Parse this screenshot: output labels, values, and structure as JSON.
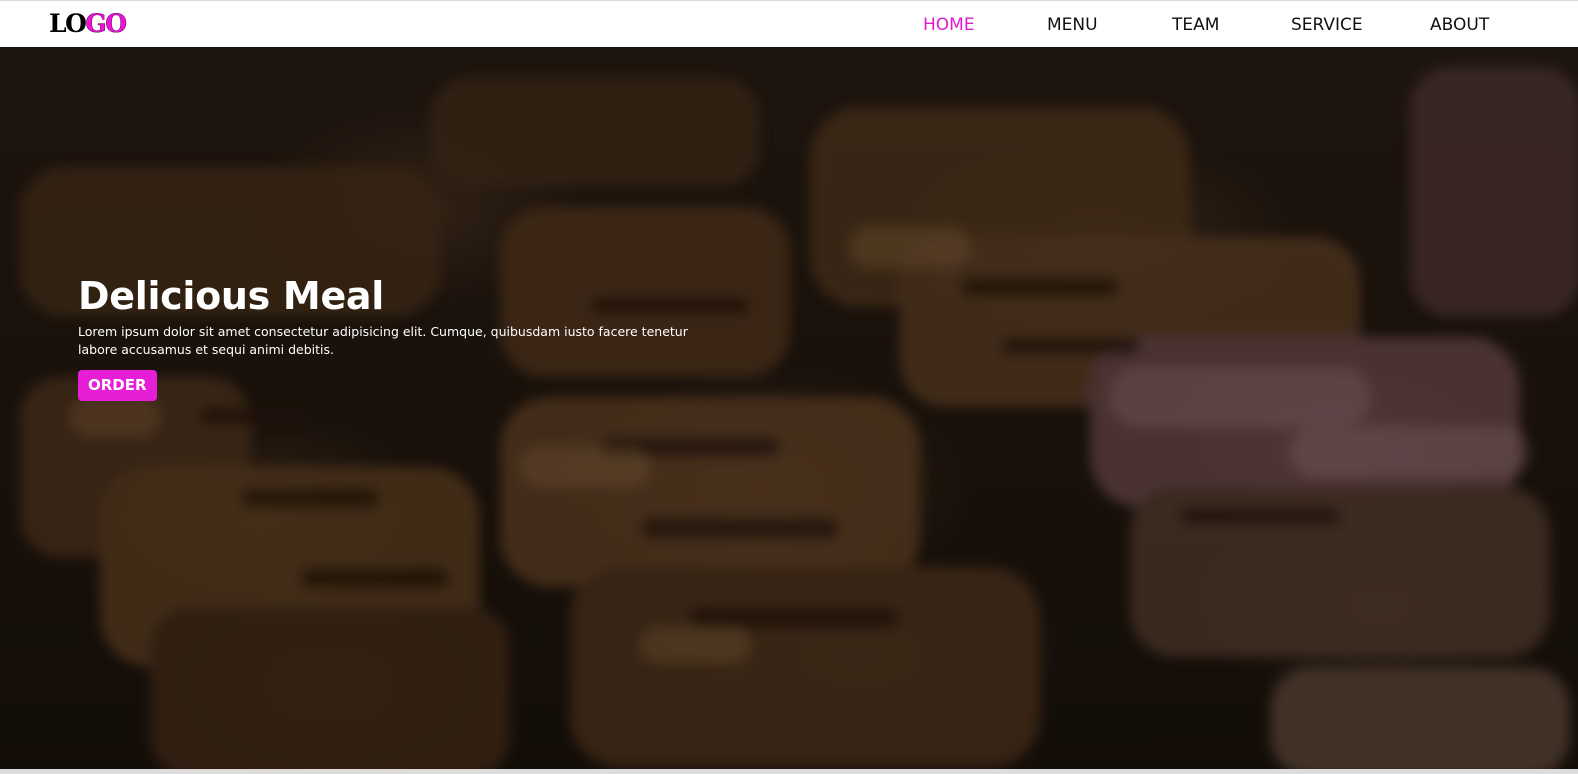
{
  "brand": {
    "logo_part1": "LO",
    "logo_part2": "GO",
    "accent_color": "#e61ed6"
  },
  "nav": {
    "items": [
      {
        "label": "HOME",
        "active": true
      },
      {
        "label": "MENU",
        "active": false
      },
      {
        "label": "TEAM",
        "active": false
      },
      {
        "label": "SERVICE",
        "active": false
      },
      {
        "label": "ABOUT",
        "active": false
      }
    ]
  },
  "hero": {
    "title": "Delicious Meal",
    "text": "Lorem ipsum dolor sit amet consectetur adipisicing elit. Cumque, quibusdam iusto facere tenetur labore accusamus et sequi animi debitis.",
    "button_label": "ORDER",
    "background_image": "grilled-meat-photo"
  }
}
